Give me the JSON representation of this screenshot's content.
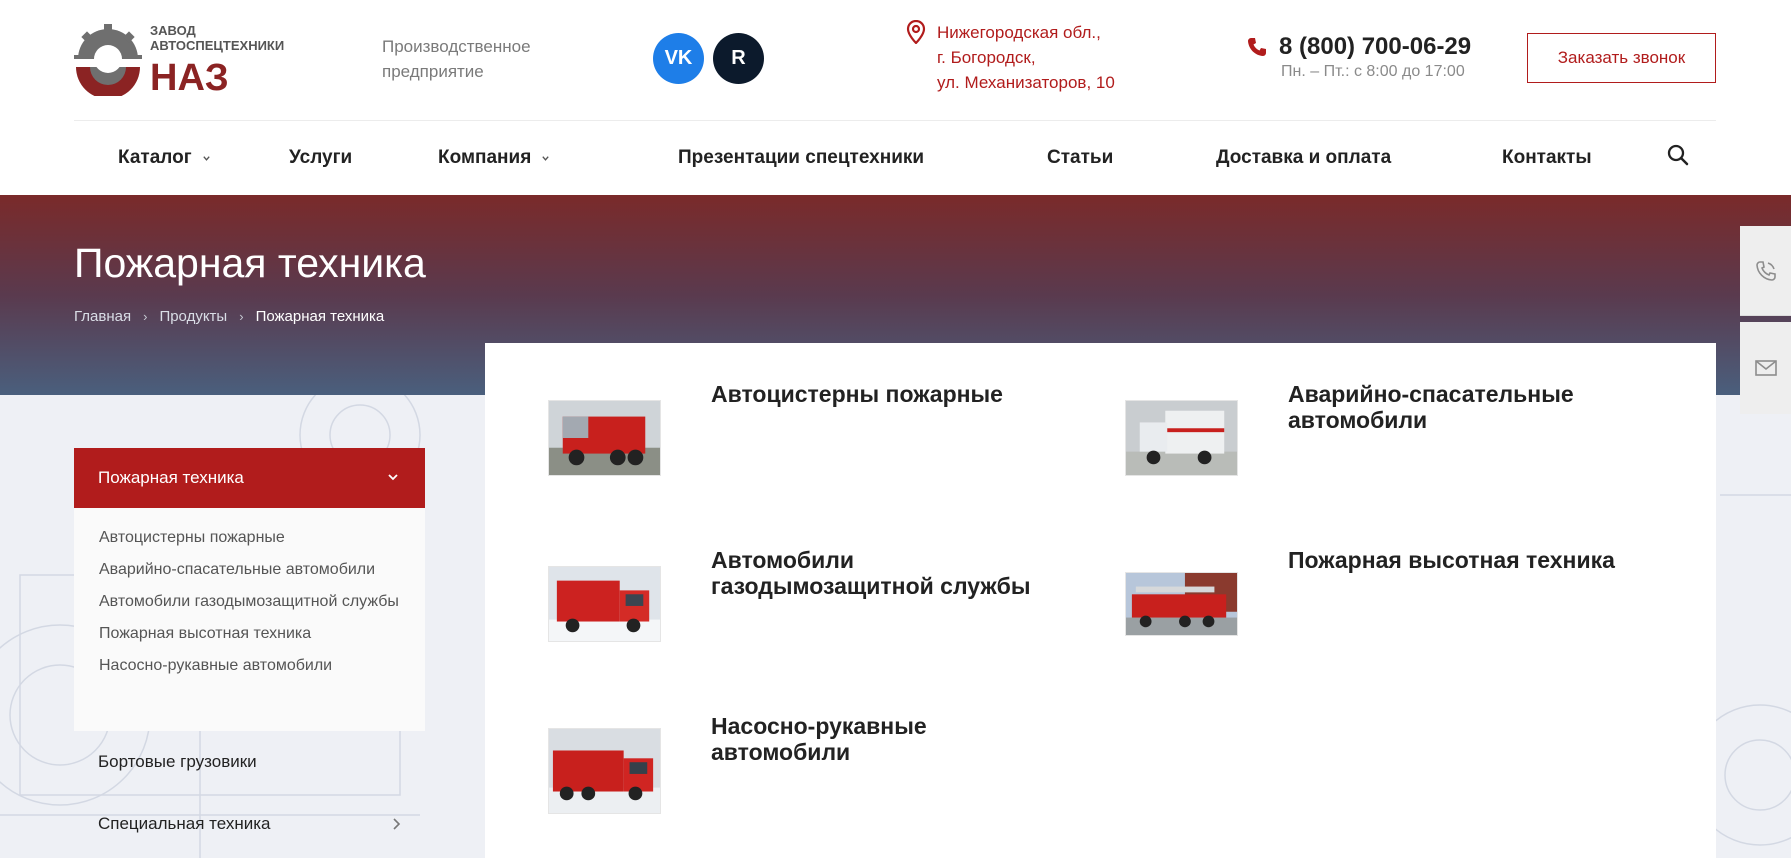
{
  "header": {
    "logo": {
      "line1": "ЗАВОД",
      "line2": "АВТОСПЕЦТЕХНИКИ",
      "brand": "НАЗ"
    },
    "tagline": "Производственное предприятие",
    "social": {
      "vk_label": "VK",
      "rt_label": "R"
    },
    "address": [
      "Нижегородская обл.,",
      "г. Богородск,",
      "ул. Механизаторов, 10"
    ],
    "phone": "8 (800) 700-06-29",
    "hours": "Пн. – Пт.: с 8:00 до 17:00",
    "callback_label": "Заказать звонок"
  },
  "nav": {
    "items": [
      {
        "label": "Каталог",
        "has_dropdown": true
      },
      {
        "label": "Услуги",
        "has_dropdown": false
      },
      {
        "label": "Компания",
        "has_dropdown": true
      },
      {
        "label": "Презентации спецтехники",
        "has_dropdown": false
      },
      {
        "label": "Статьи",
        "has_dropdown": false
      },
      {
        "label": "Доставка и оплата",
        "has_dropdown": false
      },
      {
        "label": "Контакты",
        "has_dropdown": false
      }
    ]
  },
  "hero": {
    "title": "Пожарная техника",
    "breadcrumb": [
      "Главная",
      "Продукты",
      "Пожарная техника"
    ]
  },
  "sidebar": {
    "active": "Пожарная техника",
    "sub_items": [
      "Автоцистерны пожарные",
      "Аварийно-спасательные автомобили",
      "Автомобили газодымозащитной службы",
      "Пожарная высотная техника",
      "Насосно-рукавные автомобили"
    ],
    "items": [
      "Бортовые грузовики",
      "Специальная техника"
    ]
  },
  "products": [
    {
      "name": "Автоцистерны пожарные"
    },
    {
      "name": "Аварийно-спасательные автомобили"
    },
    {
      "name": "Автомобили газодымозащитной службы"
    },
    {
      "name": "Пожарная высотная техника"
    },
    {
      "name": "Насосно-рукавные автомобили"
    }
  ],
  "colors": {
    "accent": "#b11c1c",
    "vk": "#1e7ee8",
    "rutube": "#0c1a2c",
    "hero_top": "#7a2a2a",
    "hero_bottom": "#4a5f7d"
  },
  "icons": [
    "location-pin-icon",
    "phone-icon",
    "search-icon",
    "chevron-down-icon",
    "chevron-right-icon",
    "phone-tab-icon",
    "mail-tab-icon"
  ]
}
